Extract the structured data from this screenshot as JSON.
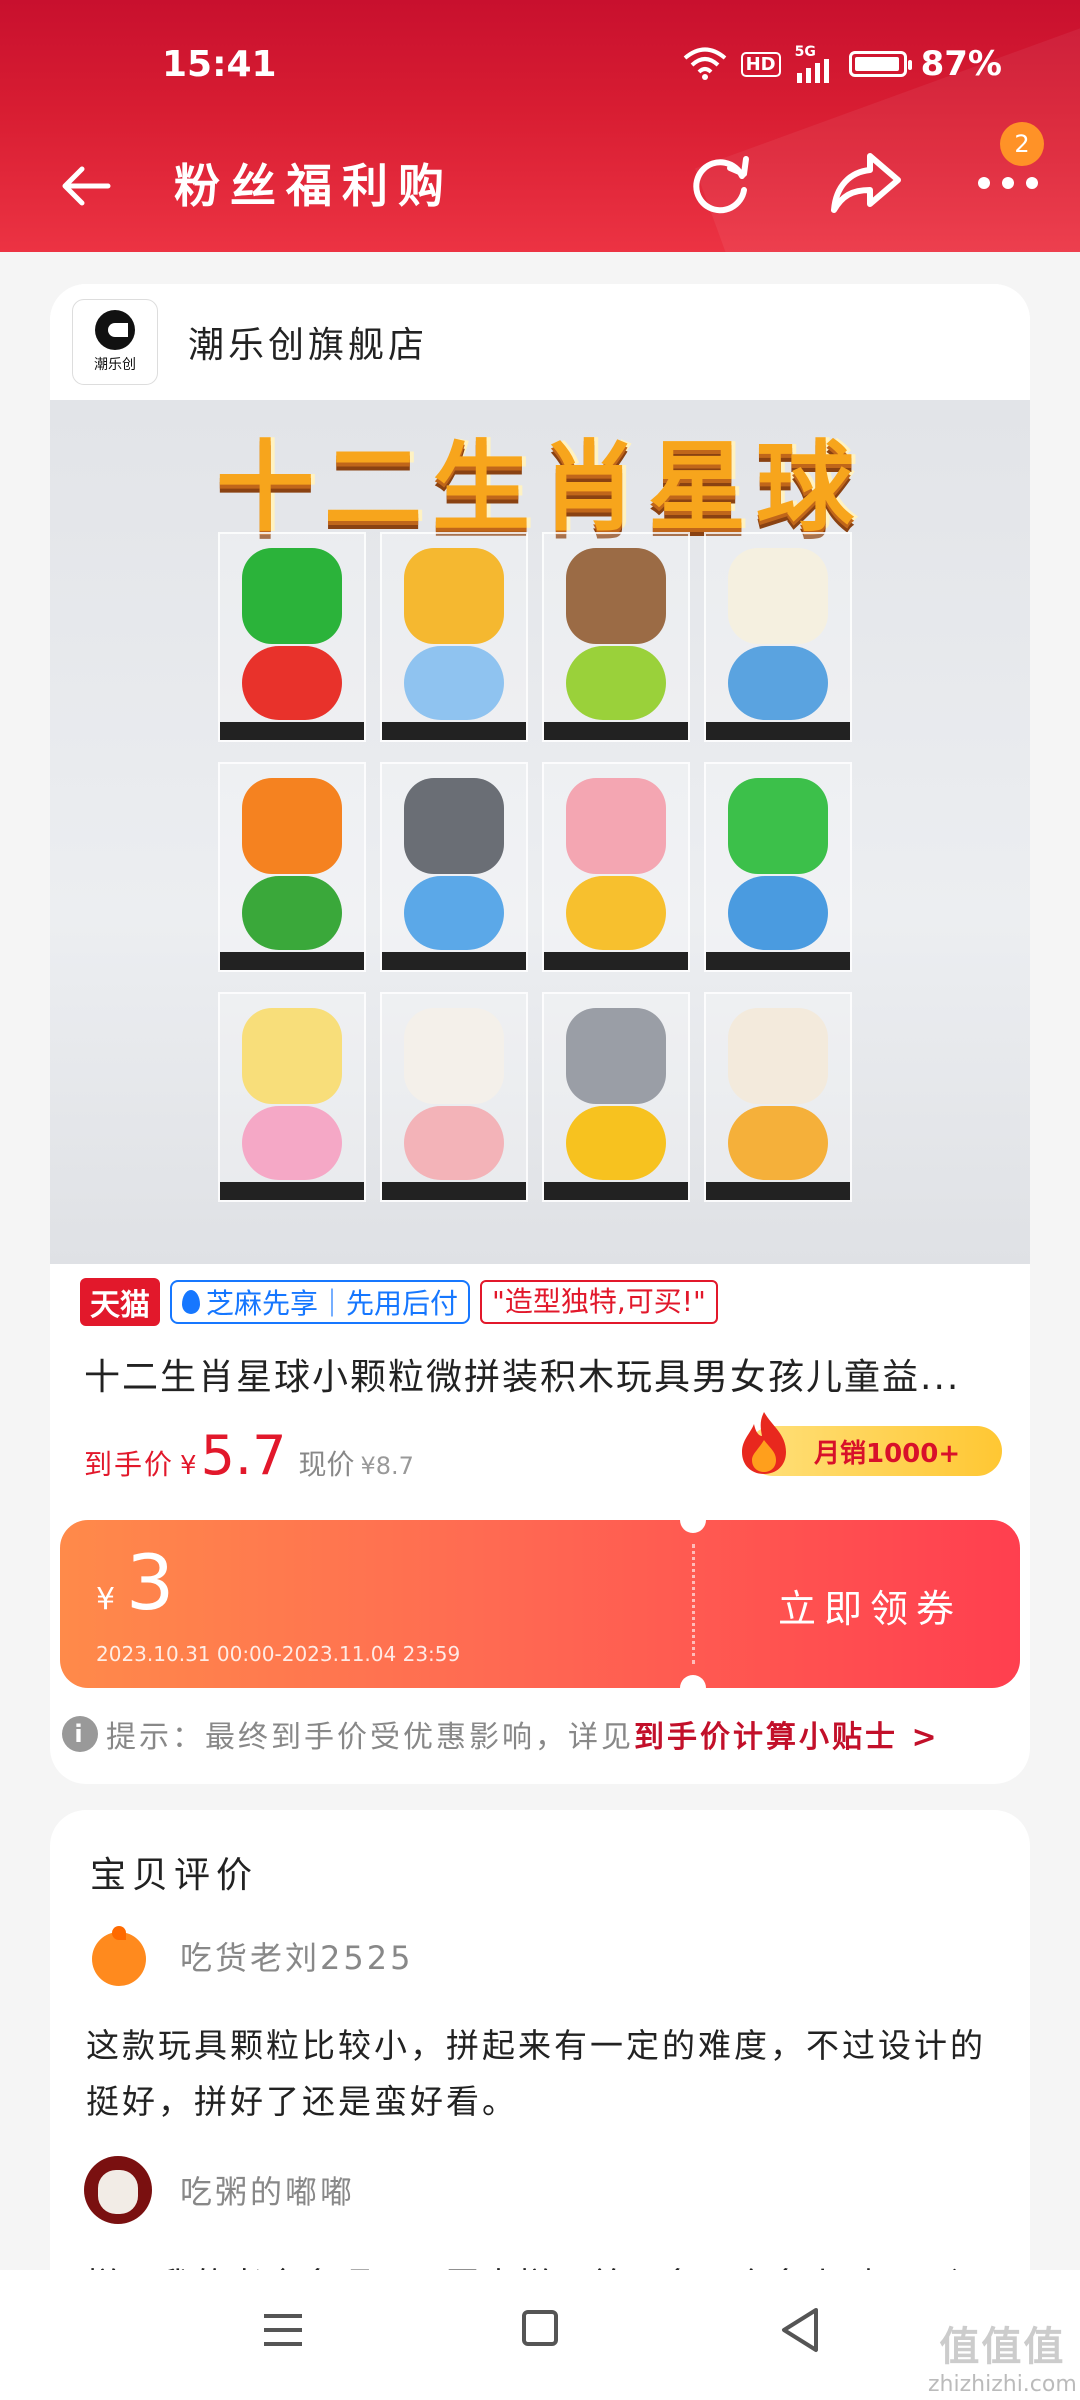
{
  "status_bar": {
    "time": "15:41",
    "network": "5G",
    "hd": "HD",
    "battery_pct": "87%"
  },
  "nav": {
    "title": "粉丝福利购",
    "badge_count": "2"
  },
  "shop": {
    "name": "潮乐创旗舰店",
    "logo_text": "潮乐创"
  },
  "product_image": {
    "banner_text": "十二生肖星球"
  },
  "tags": {
    "tmall": "天猫",
    "zhima": "芝麻先享｜先用后付",
    "slogan": "\"造型独特,可买!\""
  },
  "product": {
    "title": "十二生肖星球小颗粒微拼装积木玩具男女孩儿童益...",
    "price_label": "到手价",
    "price_currency": "¥",
    "price_value": "5.7",
    "original_label": "现价",
    "original_value": "¥8.7",
    "sales": "月销1000+"
  },
  "coupon": {
    "currency": "¥",
    "value": "3",
    "period": "2023.10.31 00:00-2023.11.04 23:59",
    "button_label": "立即领券"
  },
  "tip": {
    "prefix": "提示：最终到手价受优惠影响，详见",
    "link": "到手价计算小贴士 >"
  },
  "reviews": {
    "heading": "宝贝评价",
    "items": [
      {
        "user": "吃货老刘2525",
        "text": "这款玩具颗粒比较小，拼起来有一定的难度，不过设计的挺好，拼好了还是蛮好看。"
      },
      {
        "user": "吃粥的嘟嘟",
        "text": "拼了我的老命多呀，买回来拼了差不多一个多小时了，还"
      }
    ]
  },
  "watermark": {
    "line1": "值值值",
    "line2": "zhizhizhi.com"
  },
  "colors": {
    "brand_red": "#d81d32",
    "price_red": "#e2182b",
    "coupon_orange": "#ff6a52"
  },
  "icons": {
    "back": "back-arrow-icon",
    "refresh": "refresh-icon",
    "share": "share-icon",
    "more": "more-icon",
    "wifi": "wifi-icon",
    "signal": "signal-icon",
    "battery": "battery-icon",
    "info": "info-icon",
    "flame": "flame-icon"
  }
}
